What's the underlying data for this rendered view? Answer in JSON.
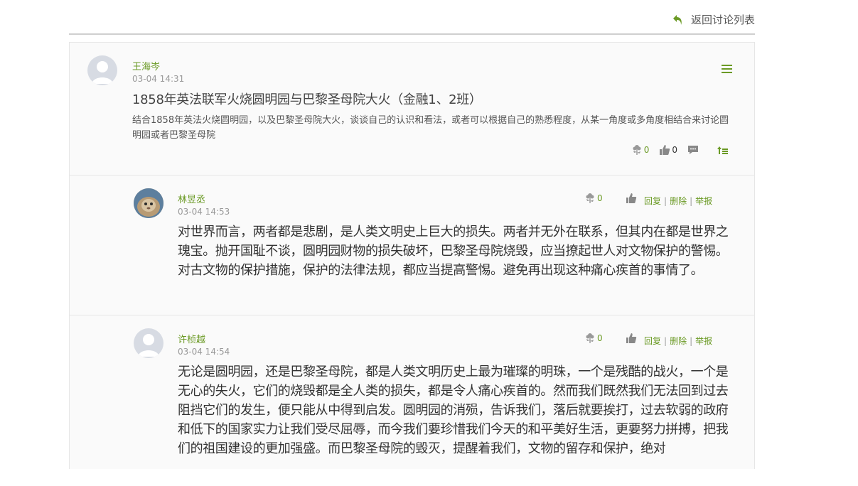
{
  "topbar": {
    "back_label": "返回讨论列表"
  },
  "post": {
    "author": "王海岑",
    "time": "03-04 14:31",
    "title": "1858年英法联军火烧圆明园与巴黎圣母院大火（金融1、2班）",
    "description": "结合1858年英法火烧圆明园，以及巴黎圣母院大火，谈谈自己的认识和看法，或者可以根据自己的熟悉程度，从某一角度或多角度相结合来讨论圆明园或者巴黎圣母院",
    "flowers": "0",
    "likes": "0"
  },
  "replies": [
    {
      "author": "林昱丞",
      "time": "03-04 14:53",
      "flowers": "0",
      "reply_label": "回复",
      "delete_label": "删除",
      "report_label": "举报",
      "content": "对世界而言，两者都是悲剧，是人类文明史上巨大的损失。两者并无外在联系，但其内在都是世界之瑰宝。抛开国耻不谈，圆明园财物的损失破坏，巴黎圣母院烧毁，应当撩起世人对文物保护的警惕。对古文物的保护措施，保护的法律法规，都应当提高警惕。避免再出现这种痛心疾首的事情了。"
    },
    {
      "author": "许桢越",
      "time": "03-04 14:54",
      "flowers": "0",
      "reply_label": "回复",
      "delete_label": "删除",
      "report_label": "举报",
      "content": "无论是圆明园，还是巴黎圣母院，都是人类文明历史上最为璀璨的明珠，一个是残酷的战火，一个是无心的失火，它们的烧毁都是全人类的损失，都是令人痛心疾首的。然而我们既然我们无法回到过去阻挡它们的发生，便只能从中得到启发。圆明园的消殒，告诉我们，落后就要挨打，过去软弱的政府和低下的国家实力让我们受尽屈辱，而今我们要珍惜我们今天的和平美好生活，更要努力拼搏，把我们的祖国建设的更加强盛。而巴黎圣母院的毁灭，提醒着我们，文物的留存和保护，绝对"
    }
  ],
  "colors": {
    "accent": "#6b9a25",
    "border": "#e6e6e6",
    "panel_bg": "#fafafa",
    "topbar_line": "#cfcfcf"
  },
  "icons": [
    "return-arrow-icon",
    "menu-icon",
    "flower-icon",
    "thumbs-up-icon",
    "comment-icon",
    "sort-icon"
  ]
}
